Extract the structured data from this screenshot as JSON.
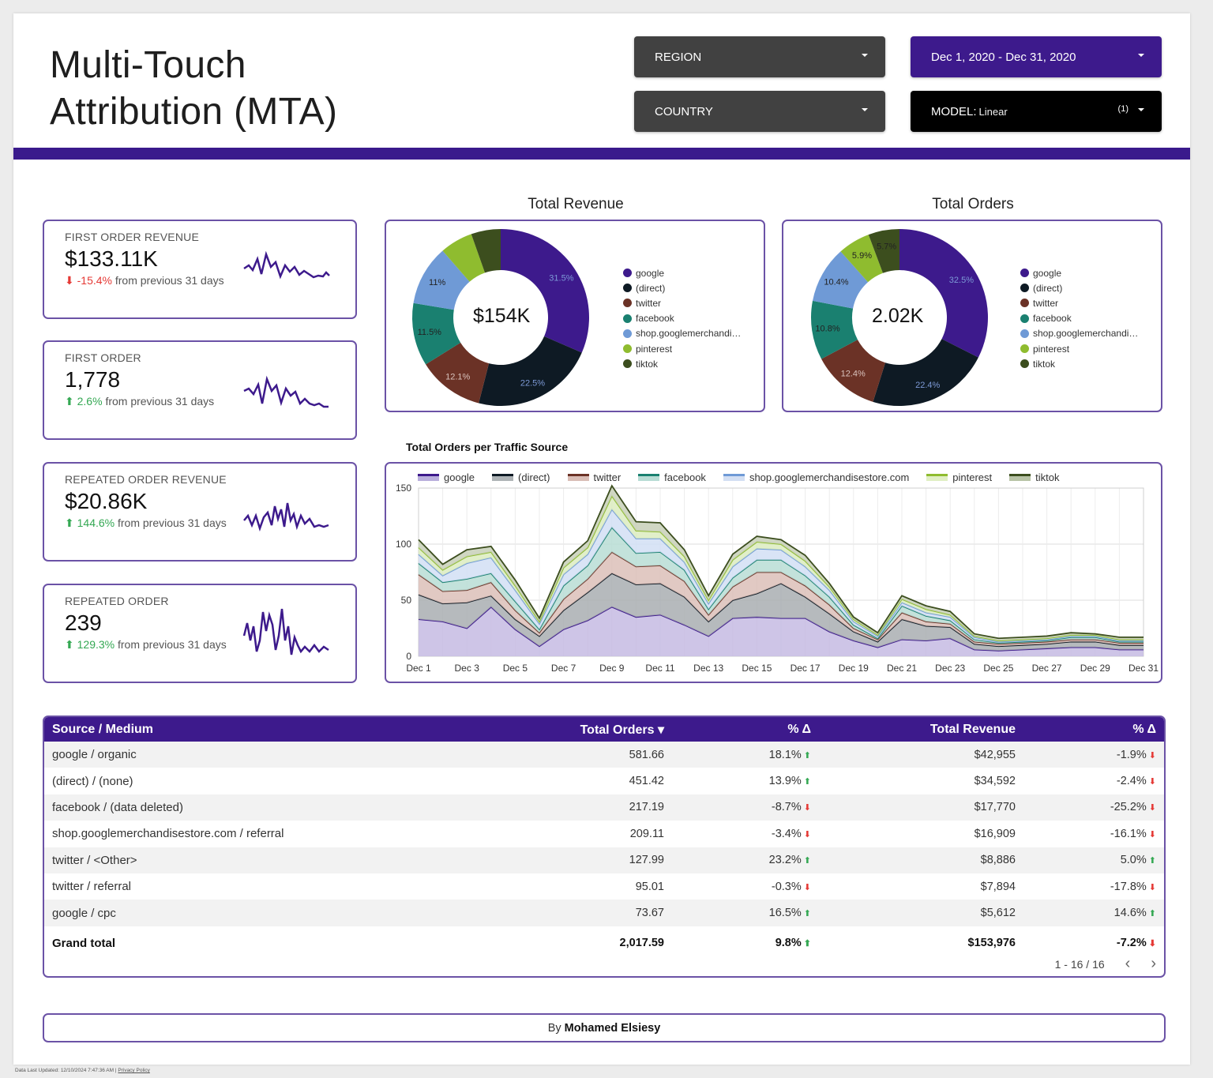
{
  "header": {
    "title_line1": "Multi-Touch",
    "title_line2": "Attribution (MTA)"
  },
  "filters": {
    "region": "REGION",
    "country": "COUNTRY",
    "date_range": "Dec 1, 2020 - Dec 31, 2020",
    "model_label": "MODEL:",
    "model_value": "Linear",
    "model_count": "(1)"
  },
  "kpis": [
    {
      "label": "FIRST ORDER REVENUE",
      "value": "$133.11K",
      "delta": "-15.4%",
      "direction": "down",
      "suffix": "from previous 31 days"
    },
    {
      "label": "FIRST ORDER",
      "value": "1,778",
      "delta": "2.6%",
      "direction": "up",
      "suffix": "from previous 31 days"
    },
    {
      "label": "REPEATED ORDER REVENUE",
      "value": "$20.86K",
      "delta": "144.6%",
      "direction": "up",
      "suffix": "from previous 31 days"
    },
    {
      "label": "REPEATED ORDER",
      "value": "239",
      "delta": "129.3%",
      "direction": "up",
      "suffix": "from previous 31 days"
    }
  ],
  "colors": {
    "brand": "#3d1a8c",
    "accent_border": "#6b52a6",
    "google": "#3d1a8c",
    "direct": "#0e1a24",
    "twitter": "#6b3226",
    "facebook": "#1a8070",
    "shop": "#6f9ad6",
    "pinterest": "#8fbc2f",
    "tiktok": "#3c4e1e",
    "up": "#34a853",
    "down": "#e53935"
  },
  "donuts": {
    "revenue": {
      "title": "Total Revenue",
      "center": "$154K"
    },
    "orders": {
      "title": "Total Orders",
      "center": "2.02K"
    }
  },
  "legend": {
    "labels": [
      "google",
      "(direct)",
      "twitter",
      "facebook",
      "shop.googlemerchandi…",
      "pinterest",
      "tiktok"
    ]
  },
  "area": {
    "title": "Total Orders per Traffic Source",
    "legend": [
      "google",
      "(direct)",
      "twitter",
      "facebook",
      "shop.googlemerchandisestore.com",
      "pinterest",
      "tiktok"
    ]
  },
  "chart_data": [
    {
      "type": "pie",
      "title": "Total Revenue",
      "categories": [
        "google",
        "(direct)",
        "twitter",
        "facebook",
        "shop.googlemerchandi…",
        "pinterest",
        "tiktok"
      ],
      "values": [
        31.5,
        22.5,
        12.1,
        11.5,
        11.0,
        6.0,
        5.4
      ],
      "labels": [
        "31.5%",
        "22.5%",
        "12.1%",
        "11.5%",
        "11%",
        "",
        ""
      ],
      "center_label": "$154K",
      "legend": "right"
    },
    {
      "type": "pie",
      "title": "Total Orders",
      "categories": [
        "google",
        "(direct)",
        "twitter",
        "facebook",
        "shop.googlemerchandi…",
        "pinterest",
        "tiktok"
      ],
      "values": [
        32.5,
        22.4,
        12.4,
        10.8,
        10.4,
        5.9,
        5.7
      ],
      "labels": [
        "32.5%",
        "22.4%",
        "12.4%",
        "10.8%",
        "10.4%",
        "5.9%",
        "5.7%"
      ],
      "center_label": "2.02K",
      "legend": "right"
    },
    {
      "type": "area",
      "title": "Total Orders per Traffic Source",
      "stacked": true,
      "x": [
        "Dec 1",
        "Dec 2",
        "Dec 3",
        "Dec 4",
        "Dec 5",
        "Dec 6",
        "Dec 7",
        "Dec 8",
        "Dec 9",
        "Dec 10",
        "Dec 11",
        "Dec 12",
        "Dec 13",
        "Dec 14",
        "Dec 15",
        "Dec 16",
        "Dec 17",
        "Dec 18",
        "Dec 19",
        "Dec 20",
        "Dec 21",
        "Dec 22",
        "Dec 23",
        "Dec 24",
        "Dec 25",
        "Dec 26",
        "Dec 27",
        "Dec 28",
        "Dec 29",
        "Dec 30",
        "Dec 31"
      ],
      "xticks": [
        "Dec 1",
        "Dec 3",
        "Dec 5",
        "Dec 7",
        "Dec 9",
        "Dec 11",
        "Dec 13",
        "Dec 15",
        "Dec 17",
        "Dec 19",
        "Dec 21",
        "Dec 23",
        "Dec 25",
        "Dec 27",
        "Dec 29",
        "Dec 31"
      ],
      "yticks": [
        0,
        50,
        100,
        150
      ],
      "ylim": [
        0,
        150
      ],
      "grid": true,
      "legend": "top",
      "series": [
        {
          "name": "google",
          "values": [
            33,
            31,
            25,
            44,
            24,
            9,
            24,
            32,
            44,
            35,
            37,
            28,
            18,
            34,
            35,
            34,
            34,
            22,
            14,
            8,
            15,
            14,
            16,
            6,
            5,
            6,
            7,
            8,
            8,
            6,
            6
          ]
        },
        {
          "name": "(direct)",
          "values": [
            22,
            16,
            23,
            10,
            9,
            9,
            17,
            25,
            30,
            29,
            28,
            25,
            13,
            16,
            21,
            31,
            19,
            16,
            8,
            5,
            18,
            13,
            10,
            5,
            4,
            4,
            4,
            5,
            5,
            4,
            4
          ]
        },
        {
          "name": "twitter",
          "values": [
            18,
            11,
            11,
            12,
            8,
            3,
            10,
            12,
            19,
            16,
            16,
            14,
            6,
            12,
            19,
            10,
            10,
            8,
            3,
            2,
            6,
            4,
            3,
            2,
            2,
            2,
            2,
            2,
            2,
            2,
            2
          ]
        },
        {
          "name": "facebook",
          "values": [
            10,
            8,
            10,
            8,
            8,
            3,
            12,
            12,
            22,
            12,
            12,
            10,
            5,
            8,
            11,
            11,
            9,
            7,
            3,
            1,
            6,
            5,
            3,
            2,
            1,
            1,
            1,
            2,
            2,
            1,
            1
          ]
        },
        {
          "name": "shop.googlemerchandisestore.com",
          "values": [
            8,
            6,
            14,
            14,
            10,
            5,
            10,
            10,
            16,
            13,
            12,
            7,
            5,
            10,
            10,
            9,
            8,
            6,
            3,
            2,
            3,
            3,
            3,
            2,
            1,
            1,
            1,
            1,
            1,
            1,
            1
          ]
        },
        {
          "name": "pinterest",
          "values": [
            6,
            5,
            6,
            5,
            4,
            2,
            6,
            6,
            12,
            7,
            6,
            5,
            3,
            6,
            6,
            5,
            5,
            3,
            2,
            1,
            3,
            3,
            2,
            1,
            1,
            1,
            1,
            1,
            1,
            1,
            1
          ]
        },
        {
          "name": "tiktok",
          "values": [
            7,
            5,
            6,
            5,
            5,
            3,
            5,
            6,
            9,
            8,
            8,
            6,
            4,
            5,
            5,
            4,
            5,
            3,
            2,
            2,
            3,
            3,
            3,
            2,
            2,
            2,
            2,
            2,
            1,
            2,
            2
          ]
        }
      ]
    }
  ],
  "table": {
    "columns": [
      "Source / Medium",
      "Total Orders ▾",
      "% Δ",
      "Total Revenue",
      "% Δ"
    ],
    "rows": [
      {
        "source": "google / organic",
        "orders": "581.66",
        "orders_delta": "18.1%",
        "orders_dir": "up",
        "revenue": "$42,955",
        "revenue_delta": "-1.9%",
        "revenue_dir": "down"
      },
      {
        "source": "(direct) / (none)",
        "orders": "451.42",
        "orders_delta": "13.9%",
        "orders_dir": "up",
        "revenue": "$34,592",
        "revenue_delta": "-2.4%",
        "revenue_dir": "down"
      },
      {
        "source": "facebook / (data deleted)",
        "orders": "217.19",
        "orders_delta": "-8.7%",
        "orders_dir": "down",
        "revenue": "$17,770",
        "revenue_delta": "-25.2%",
        "revenue_dir": "down"
      },
      {
        "source": "shop.googlemerchandisestore.com / referral",
        "orders": "209.11",
        "orders_delta": "-3.4%",
        "orders_dir": "down",
        "revenue": "$16,909",
        "revenue_delta": "-16.1%",
        "revenue_dir": "down"
      },
      {
        "source": "twitter / <Other>",
        "orders": "127.99",
        "orders_delta": "23.2%",
        "orders_dir": "up",
        "revenue": "$8,886",
        "revenue_delta": "5.0%",
        "revenue_dir": "up"
      },
      {
        "source": "twitter / referral",
        "orders": "95.01",
        "orders_delta": "-0.3%",
        "orders_dir": "down",
        "revenue": "$7,894",
        "revenue_delta": "-17.8%",
        "revenue_dir": "down"
      },
      {
        "source": "google / cpc",
        "orders": "73.67",
        "orders_delta": "16.5%",
        "orders_dir": "up",
        "revenue": "$5,612",
        "revenue_delta": "14.6%",
        "revenue_dir": "up"
      }
    ],
    "total": {
      "source": "Grand total",
      "orders": "2,017.59",
      "orders_delta": "9.8%",
      "orders_dir": "up",
      "revenue": "$153,976",
      "revenue_delta": "-7.2%",
      "revenue_dir": "down"
    },
    "pagination": "1 - 16 / 16"
  },
  "footer": {
    "by": "By",
    "author": "Mohamed Elsiesy"
  },
  "meta_line": {
    "updated": "Data Last Updated: 12/10/2024 7:47:36 AM",
    "separator": "|",
    "privacy": "Privacy Policy"
  }
}
